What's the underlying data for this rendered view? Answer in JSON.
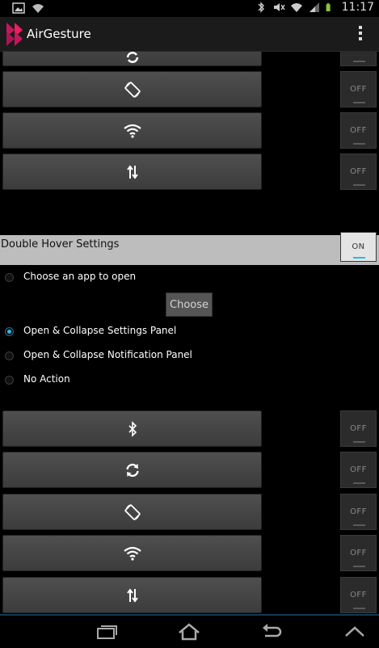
{
  "status_bar": {
    "time": "11:17",
    "icons": [
      "gallery-icon",
      "wifi-icon",
      "bluetooth-icon",
      "mute-icon",
      "wifi-icon",
      "signal-icon",
      "battery-icon"
    ],
    "battery_color": "#8bc34a"
  },
  "action_bar": {
    "title": "AirGesture",
    "logo_color": "#c2185b"
  },
  "top_section": {
    "toggles": [
      {
        "icon": "sync-icon",
        "state": "OFF"
      },
      {
        "icon": "rotate-icon",
        "state": "OFF"
      },
      {
        "icon": "wifi-icon",
        "state": "OFF"
      },
      {
        "icon": "data-transfer-icon",
        "state": "OFF"
      }
    ]
  },
  "double_hover": {
    "title": "Double Hover Settings",
    "toggle": "ON",
    "options": [
      {
        "label": "Choose an app to open",
        "selected": false
      },
      {
        "label": "Open & Collapse Settings Panel",
        "selected": true
      },
      {
        "label": "Open & Collapse Notification Panel",
        "selected": false
      },
      {
        "label": "No Action",
        "selected": false
      }
    ],
    "choose_button": "Choose",
    "toggles": [
      {
        "icon": "bluetooth-icon",
        "state": "OFF"
      },
      {
        "icon": "sync-icon",
        "state": "OFF"
      },
      {
        "icon": "rotate-icon",
        "state": "OFF"
      },
      {
        "icon": "wifi-icon",
        "state": "OFF"
      },
      {
        "icon": "data-transfer-icon",
        "state": "OFF"
      }
    ]
  },
  "nav_bar": {
    "buttons": [
      "recent-apps-icon",
      "home-icon",
      "back-icon",
      "chevron-up-icon"
    ]
  },
  "colors": {
    "accent": "#33b5e5",
    "section_header": "#bdbdbd",
    "button": "#474747"
  }
}
